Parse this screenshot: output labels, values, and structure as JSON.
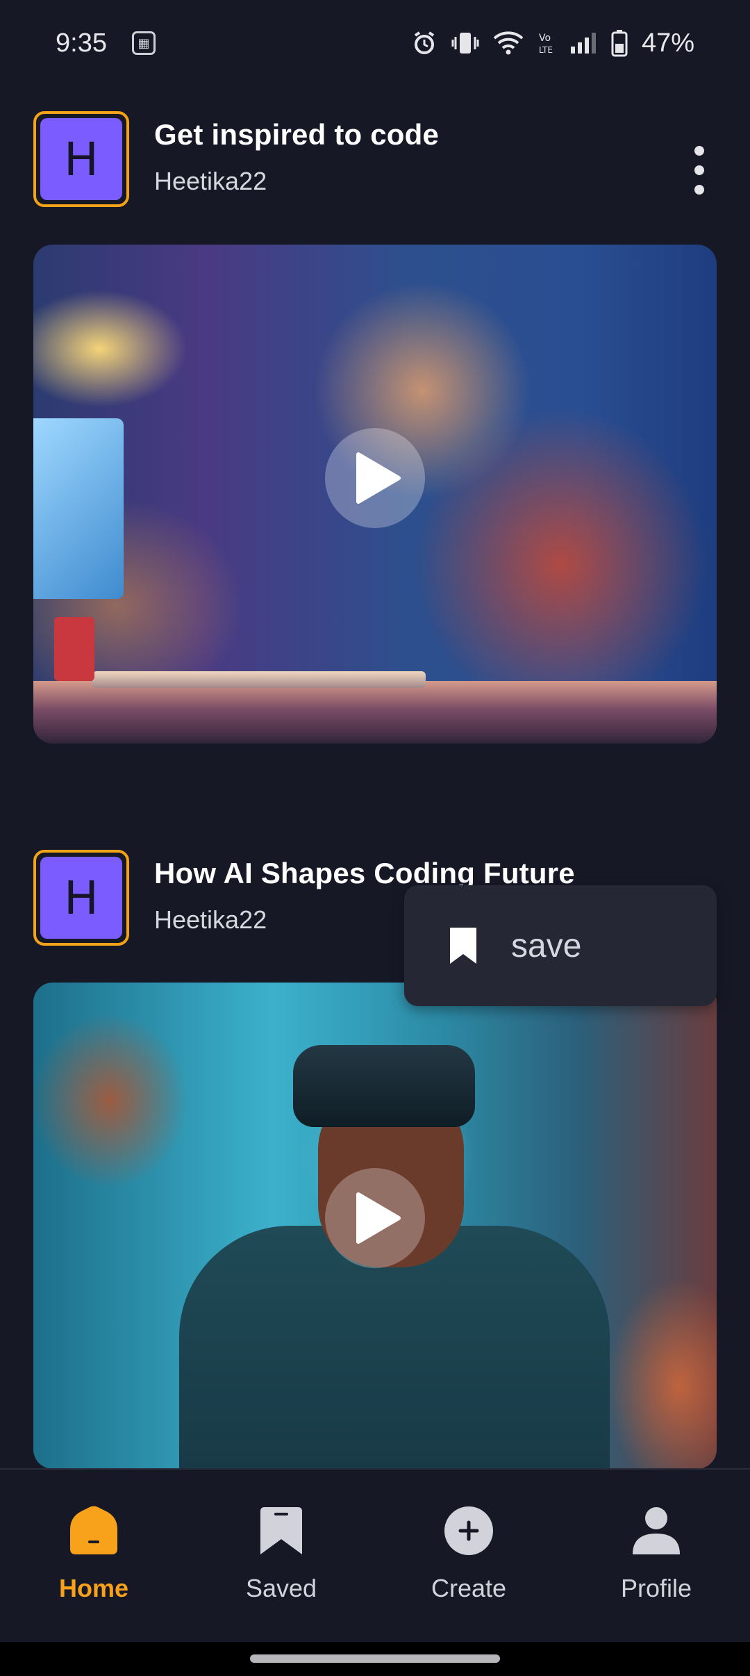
{
  "status_bar": {
    "time": "9:35",
    "battery": "47%",
    "icons": [
      "sim-toolkit-icon",
      "alarm-icon",
      "vibrate-icon",
      "wifi-icon",
      "volte-icon",
      "signal-icon",
      "battery-icon"
    ]
  },
  "feed": {
    "posts": [
      {
        "avatar_letter": "H",
        "title": "Get inspired to code",
        "author": "Heetika22"
      },
      {
        "avatar_letter": "H",
        "title": "How AI Shapes Coding Future",
        "author": "Heetika22"
      }
    ]
  },
  "popup_menu": {
    "items": [
      {
        "label": "save",
        "icon": "bookmark-icon"
      }
    ]
  },
  "bottom_nav": {
    "items": [
      {
        "label": "Home",
        "icon": "home-icon",
        "active": true
      },
      {
        "label": "Saved",
        "icon": "bookmark-icon",
        "active": false
      },
      {
        "label": "Create",
        "icon": "plus-circle-icon",
        "active": false
      },
      {
        "label": "Profile",
        "icon": "person-icon",
        "active": false
      }
    ]
  },
  "colors": {
    "background": "#171826",
    "accent": "#f8a21b",
    "avatar": "#7b5cff",
    "nav_icon": "#d2d3da"
  }
}
